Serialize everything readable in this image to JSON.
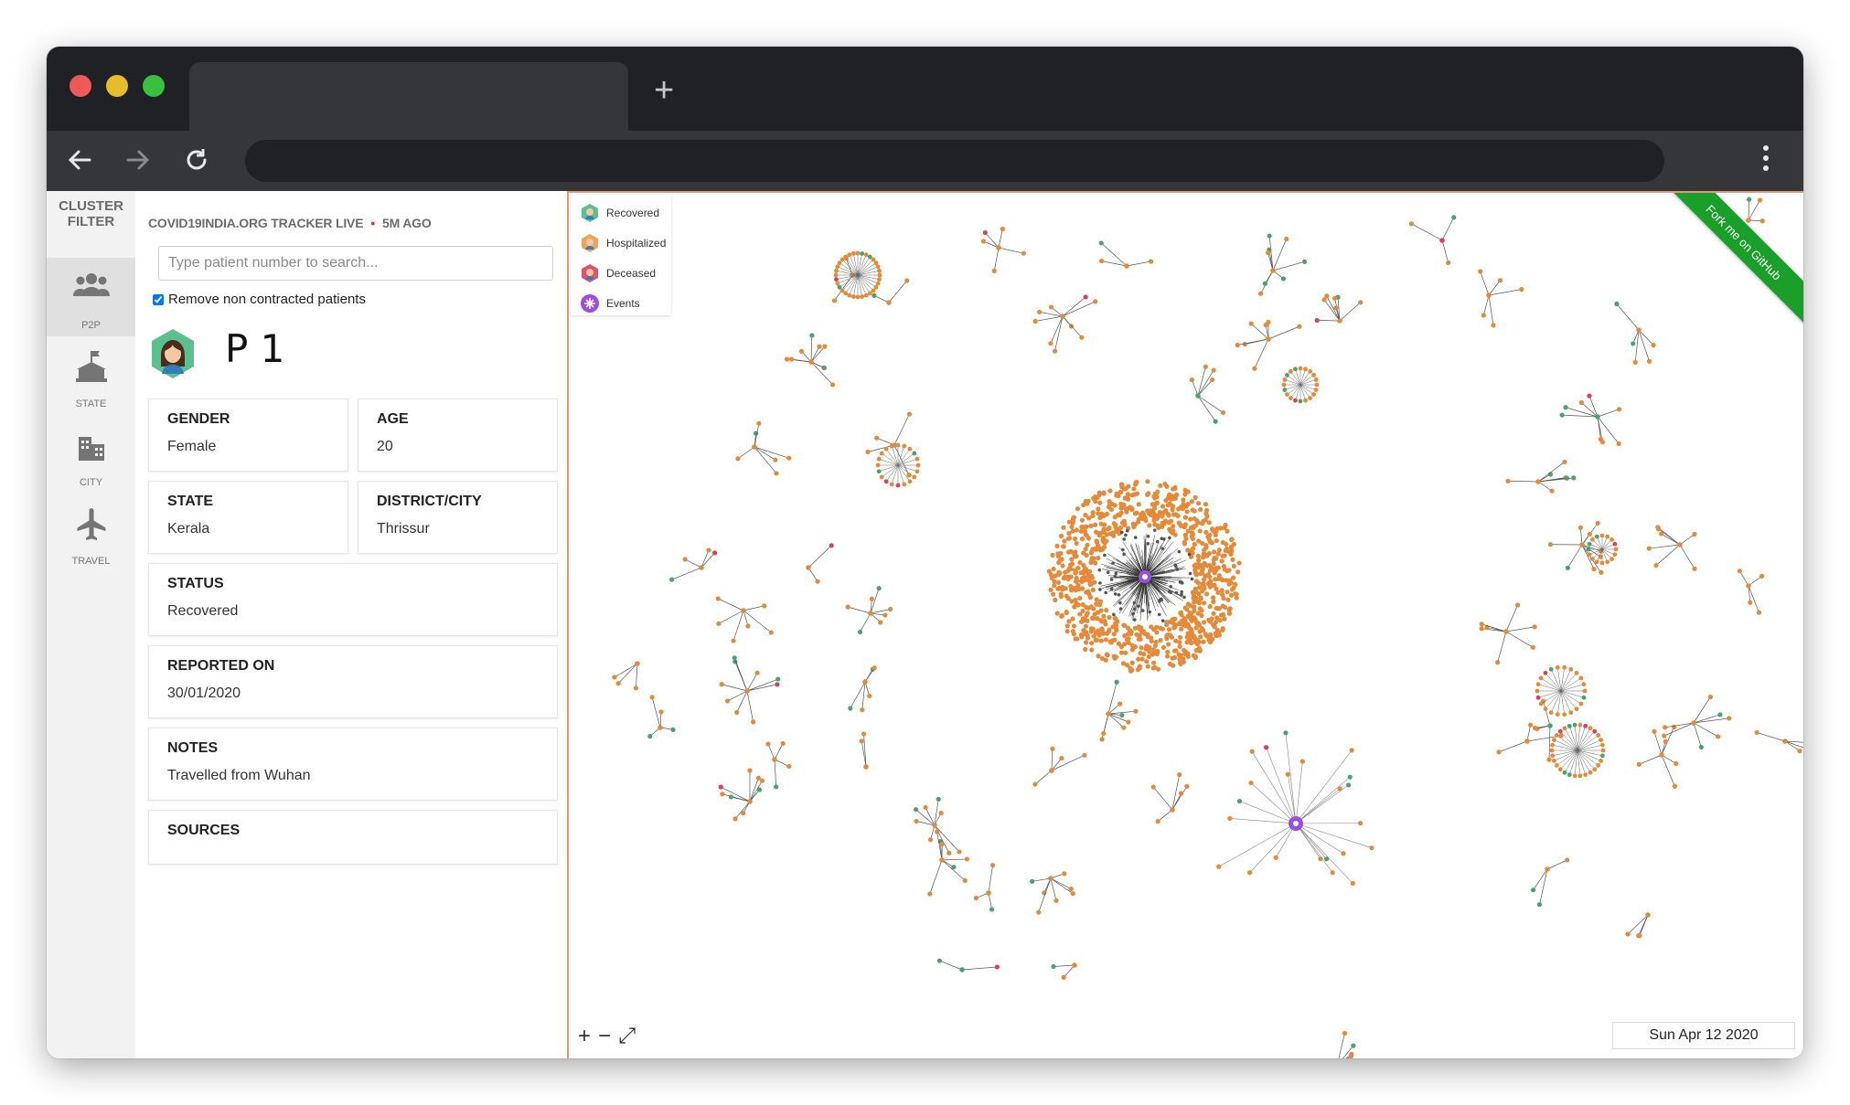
{
  "browser": {
    "tab_title": "",
    "new_tab_symbol": "+",
    "url": ""
  },
  "rail": {
    "title": "CLUSTER FILTER",
    "items": [
      {
        "label": "P2P",
        "icon": "people-icon",
        "active": true
      },
      {
        "label": "STATE",
        "icon": "state-building-icon",
        "active": false
      },
      {
        "label": "CITY",
        "icon": "city-icon",
        "active": false
      },
      {
        "label": "TRAVEL",
        "icon": "airplane-icon",
        "active": false
      }
    ]
  },
  "panel": {
    "source": "COVID19INDIA.ORG TRACKER LIVE",
    "updated": "5M AGO",
    "search_placeholder": "Type patient number to search...",
    "filter_label": "Remove non contracted patients",
    "filter_checked": true,
    "patient": {
      "name": "P 1",
      "status_color": "#5bbf8e",
      "fields": {
        "gender": {
          "label": "GENDER",
          "value": "Female"
        },
        "age": {
          "label": "AGE",
          "value": "20"
        },
        "state": {
          "label": "STATE",
          "value": "Kerala"
        },
        "district": {
          "label": "DISTRICT/CITY",
          "value": "Thrissur"
        },
        "status": {
          "label": "STATUS",
          "value": "Recovered"
        },
        "reported": {
          "label": "REPORTED ON",
          "value": "30/01/2020"
        },
        "notes": {
          "label": "NOTES",
          "value": "Travelled from Wuhan"
        },
        "sources": {
          "label": "SOURCES",
          "value": ""
        }
      }
    }
  },
  "graph": {
    "legend": [
      {
        "label": "Recovered",
        "color": "#5bbf8e"
      },
      {
        "label": "Hospitalized",
        "color": "#f0a35a"
      },
      {
        "label": "Deceased",
        "color": "#e4526a"
      },
      {
        "label": "Events",
        "color": "#9b4fe0"
      }
    ],
    "zoom_controls": [
      "+",
      "−",
      "⤢"
    ],
    "date": "Sun Apr 12 2020",
    "ribbon": "Fork me on GitHub",
    "node_colors": {
      "hospitalized": "#e48a3a",
      "recovered": "#4aa36d",
      "deceased": "#d9415b",
      "event": "#9b4fe0"
    }
  }
}
